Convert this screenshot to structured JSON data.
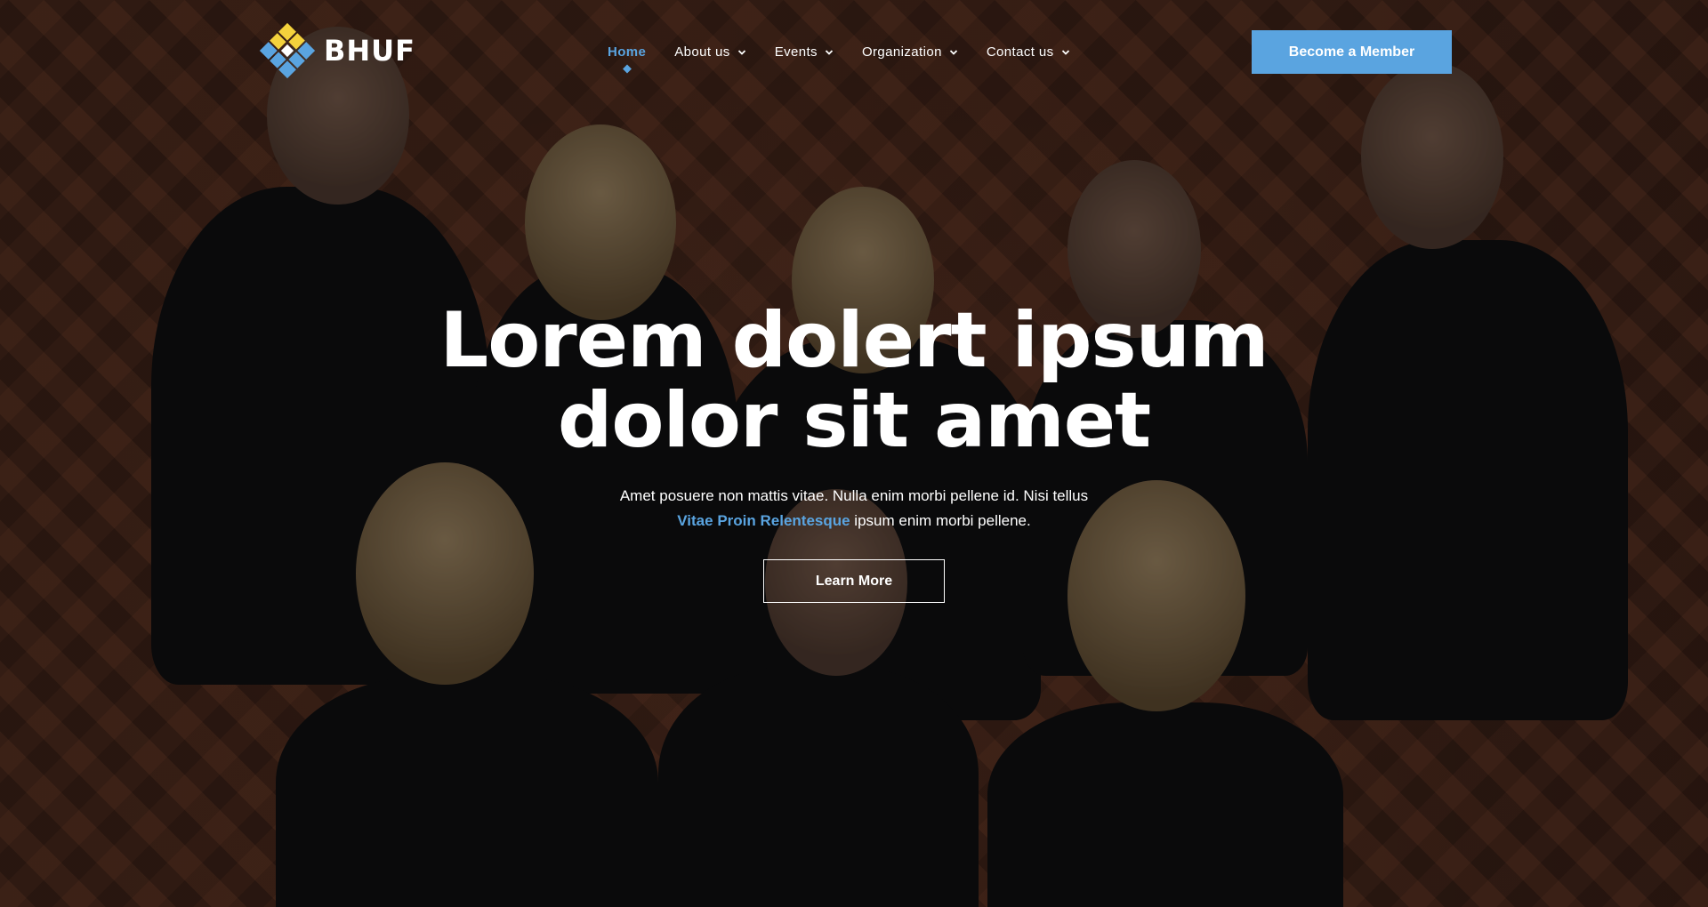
{
  "brand": {
    "name": "BHUF",
    "accent": "#5aa4e0",
    "logo_colors": [
      "#f4d23c",
      "#5aa4e0",
      "#ffffff"
    ]
  },
  "nav": {
    "items": [
      {
        "label": "Home",
        "active": true,
        "dropdown": false
      },
      {
        "label": "About us",
        "active": false,
        "dropdown": true
      },
      {
        "label": "Events",
        "active": false,
        "dropdown": true
      },
      {
        "label": "Organization",
        "active": false,
        "dropdown": true
      },
      {
        "label": "Contact us",
        "active": false,
        "dropdown": true
      }
    ],
    "cta_label": "Become a Member"
  },
  "hero": {
    "title_line1": "Lorem dolert ipsum",
    "title_line2": "dolor sit amet",
    "sub_line1": "Amet posuere non mattis vitae. Nulla enim morbi pellene id. Nisi tellus",
    "sub_highlight": "Vitae Proin Relentesque",
    "sub_line2_rest": " ipsum enim morbi pellene.",
    "button_label": "Learn More",
    "background_image": "group-photo"
  }
}
